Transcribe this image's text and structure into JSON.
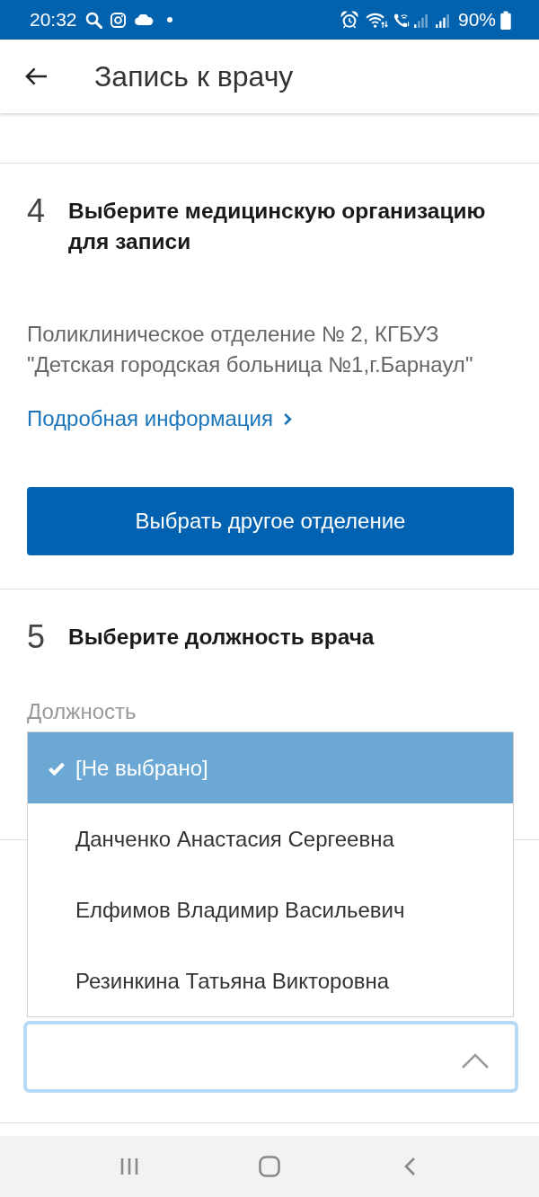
{
  "status_bar": {
    "time": "20:32",
    "battery": "90%"
  },
  "app_bar": {
    "title": "Запись к врачу"
  },
  "steps": [
    {
      "number": "4",
      "title": "Выберите медицинскую организацию для записи",
      "organization": "Поликлиническое отделение № 2, КГБУЗ \"Детская городская больница №1,г.Барнаул\"",
      "details_link": "Подробная информация",
      "button": "Выбрать другое отделение"
    },
    {
      "number": "5",
      "title": "Выберите должность врача",
      "field_label": "Должность"
    }
  ],
  "select": {
    "expanded": true,
    "options": [
      {
        "label": "[Не выбрано]",
        "selected": true
      },
      {
        "label": "Данченко Анастасия Сергеевна",
        "selected": false
      },
      {
        "label": "Елфимов Владимир Васильевич",
        "selected": false
      },
      {
        "label": "Резинкина Татьяна Викторовна",
        "selected": false
      }
    ]
  }
}
